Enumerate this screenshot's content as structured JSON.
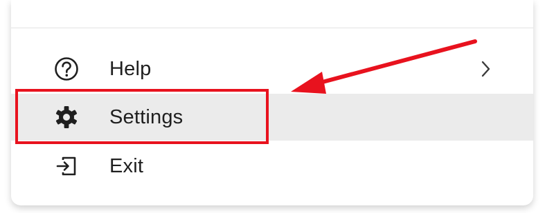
{
  "menu": {
    "items": [
      {
        "label": "Help",
        "icon": "help-circle-icon",
        "has_submenu": true
      },
      {
        "label": "Settings",
        "icon": "gear-icon",
        "highlighted": true
      },
      {
        "label": "Exit",
        "icon": "exit-icon"
      }
    ]
  },
  "annotation": {
    "color": "#e8121e"
  }
}
